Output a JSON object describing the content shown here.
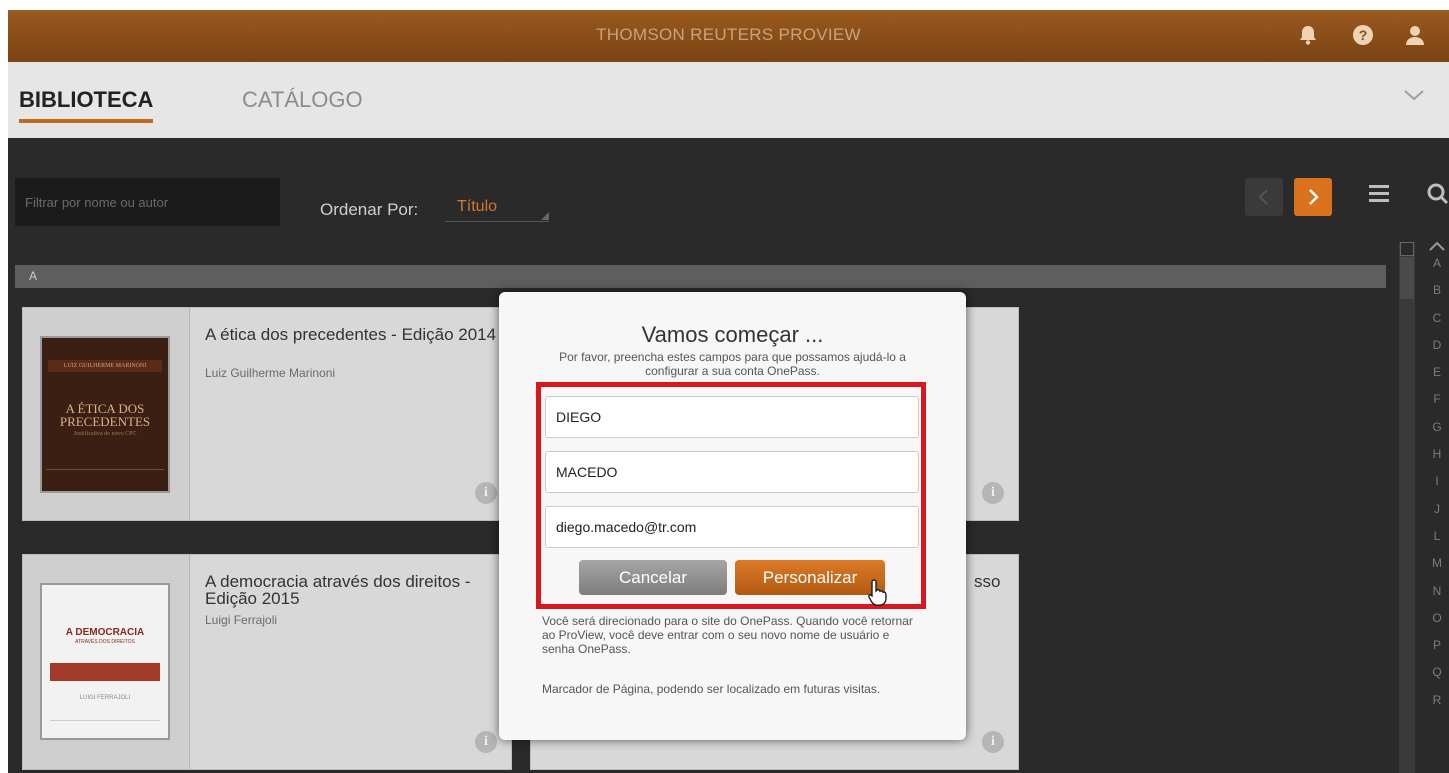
{
  "topbar": {
    "title": "THOMSON REUTERS PROVIEW",
    "icons": [
      "bell-icon",
      "help-icon",
      "user-icon"
    ],
    "help_glyph": "?"
  },
  "nav": {
    "tabs": [
      {
        "label": "BIBLIOTECA",
        "active": true
      },
      {
        "label": "CATÁLOGO",
        "active": false
      }
    ]
  },
  "toolbar": {
    "filter_placeholder": "Filtrar por nome ou autor",
    "sort_label": "Ordenar Por:",
    "sort_value": "Título"
  },
  "library": {
    "section_letter": "A",
    "alphabet": [
      "A",
      "B",
      "C",
      "D",
      "E",
      "F",
      "G",
      "H",
      "I",
      "J",
      "L",
      "M",
      "N",
      "O",
      "P",
      "Q",
      "R"
    ],
    "books": [
      {
        "title": "A ética dos precedentes - Edição 2014",
        "author": "Luiz Guilherme Marinoni",
        "cover_header": "LUIZ GUILHERME MARINONI",
        "cover_title": "A ÉTICA DOS PRECEDENTES",
        "cover_sub": "Justificativa do novo CPC"
      },
      {
        "title": "A democracia através dos direitos - Edição 2015",
        "author": "Luigi Ferrajoli",
        "cover_title": "A DEMOCRACIA",
        "cover_sub": "ATRAVÉS DOS DIREITOS",
        "cover_author": "LUIGI FERRAJOLI"
      }
    ],
    "partial_title_fragment": "sso",
    "info_glyph": "i"
  },
  "modal": {
    "title": "Vamos começar ...",
    "description": "Por favor, preencha estes campos para que possamos ajudá-lo a configurar a sua conta OnePass.",
    "first_name": "DIEGO",
    "last_name": "MACEDO",
    "email": "diego.macedo@tr.com",
    "cancel_label": "Cancelar",
    "submit_label": "Personalizar",
    "note1": "Você será direcionado para o site do OnePass. Quando você retornar ao ProView, você deve entrar com o seu novo nome de usuário e senha OnePass.",
    "note2": "Marcador de Página, podendo ser localizado em futuras visitas."
  },
  "colors": {
    "brand": "#8b4f1a",
    "accent": "#d9711d",
    "highlight": "#d7181e"
  }
}
